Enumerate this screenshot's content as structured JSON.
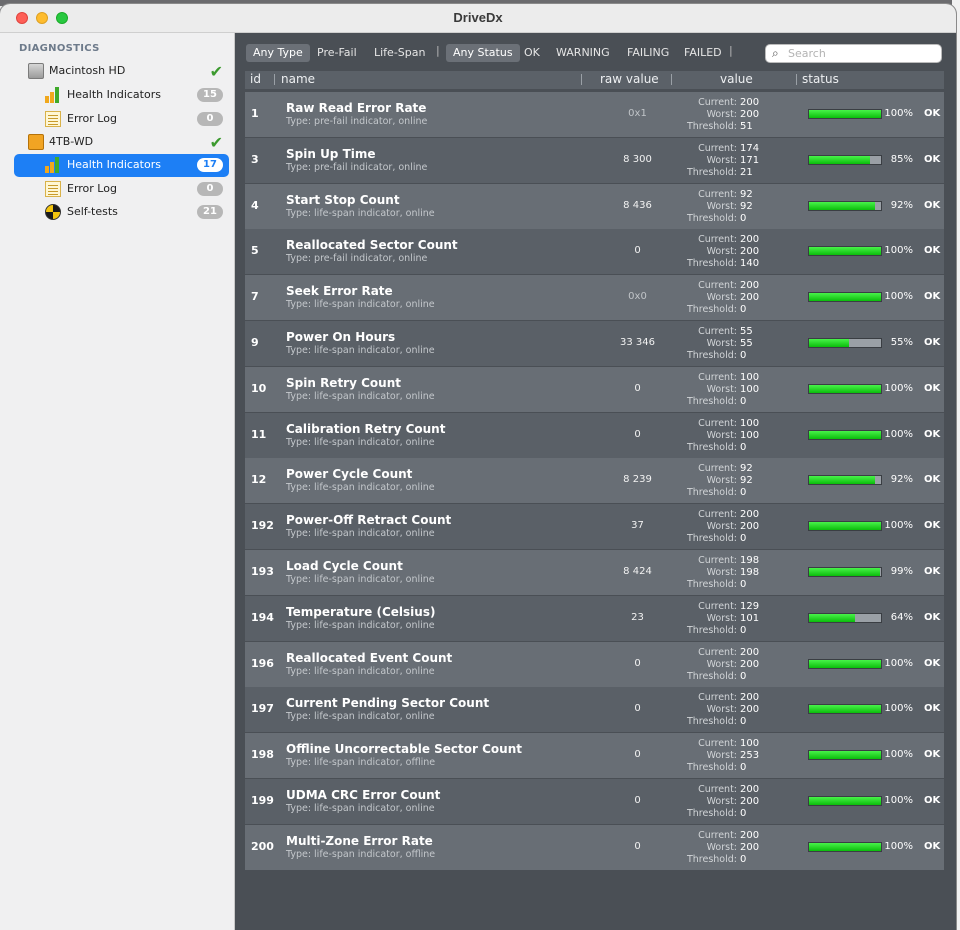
{
  "window": {
    "title": "DriveDx"
  },
  "sidebar": {
    "heading": "DIAGNOSTICS",
    "drives": [
      {
        "name": "Macintosh HD",
        "icon": "disk-icon",
        "status_icon": "check-icon",
        "items": [
          {
            "label": "Health Indicators",
            "icon": "bar-chart-icon",
            "count": "15"
          },
          {
            "label": "Error Log",
            "icon": "log-icon",
            "count": "0"
          }
        ]
      },
      {
        "name": "4TB-WD",
        "icon": "hdd-icon",
        "status_icon": "check-icon",
        "items": [
          {
            "label": "Health Indicators",
            "icon": "bar-chart-icon",
            "count": "17",
            "selected": true
          },
          {
            "label": "Error Log",
            "icon": "log-icon",
            "count": "0"
          },
          {
            "label": "Self-tests",
            "icon": "self-test-icon",
            "count": "21"
          }
        ]
      }
    ]
  },
  "filters": {
    "type": [
      "Any Type",
      "Pre-Fail",
      "Life-Span"
    ],
    "status": [
      "Any Status",
      "OK",
      "WARNING",
      "FAILING",
      "FAILED"
    ],
    "active_type": "Any Type",
    "active_status": "Any Status",
    "separator": "|",
    "search_placeholder": "Search"
  },
  "table": {
    "columns": [
      "id",
      "name",
      "raw value",
      "value",
      "status"
    ],
    "value_labels": {
      "current": "Current:",
      "worst": "Worst:",
      "threshold": "Threshold:"
    },
    "rows": [
      {
        "id": "1",
        "name": "Raw Read Error Rate",
        "type": "Type: pre-fail indicator, online",
        "raw": "0x1",
        "hex": true,
        "current": "200",
        "worst": "200",
        "threshold": "51",
        "percent": 100,
        "percent_label": "100%",
        "status": "OK"
      },
      {
        "id": "3",
        "name": "Spin Up Time",
        "type": "Type: pre-fail indicator, online",
        "raw": "8 300",
        "current": "174",
        "worst": "171",
        "threshold": "21",
        "percent": 85,
        "percent_label": "85%",
        "status": "OK"
      },
      {
        "id": "4",
        "name": "Start Stop Count",
        "type": "Type: life-span indicator, online",
        "raw": "8 436",
        "current": "92",
        "worst": "92",
        "threshold": "0",
        "percent": 92,
        "percent_label": "92%",
        "status": "OK"
      },
      {
        "id": "5",
        "name": "Reallocated Sector Count",
        "type": "Type: pre-fail indicator, online",
        "raw": "0",
        "current": "200",
        "worst": "200",
        "threshold": "140",
        "percent": 100,
        "percent_label": "100%",
        "status": "OK"
      },
      {
        "id": "7",
        "name": "Seek Error Rate",
        "type": "Type: life-span indicator, online",
        "raw": "0x0",
        "hex": true,
        "current": "200",
        "worst": "200",
        "threshold": "0",
        "percent": 100,
        "percent_label": "100%",
        "status": "OK"
      },
      {
        "id": "9",
        "name": "Power On Hours",
        "type": "Type: life-span indicator, online",
        "raw": "33 346",
        "current": "55",
        "worst": "55",
        "threshold": "0",
        "percent": 55,
        "percent_label": "55%",
        "status": "OK"
      },
      {
        "id": "10",
        "name": "Spin Retry Count",
        "type": "Type: life-span indicator, online",
        "raw": "0",
        "current": "100",
        "worst": "100",
        "threshold": "0",
        "percent": 100,
        "percent_label": "100%",
        "status": "OK"
      },
      {
        "id": "11",
        "name": "Calibration Retry Count",
        "type": "Type: life-span indicator, online",
        "raw": "0",
        "current": "100",
        "worst": "100",
        "threshold": "0",
        "percent": 100,
        "percent_label": "100%",
        "status": "OK"
      },
      {
        "id": "12",
        "name": "Power Cycle Count",
        "type": "Type: life-span indicator, online",
        "raw": "8 239",
        "current": "92",
        "worst": "92",
        "threshold": "0",
        "percent": 92,
        "percent_label": "92%",
        "status": "OK"
      },
      {
        "id": "192",
        "name": "Power-Off Retract Count",
        "type": "Type: life-span indicator, online",
        "raw": "37",
        "current": "200",
        "worst": "200",
        "threshold": "0",
        "percent": 100,
        "percent_label": "100%",
        "status": "OK"
      },
      {
        "id": "193",
        "name": "Load Cycle Count",
        "type": "Type: life-span indicator, online",
        "raw": "8 424",
        "current": "198",
        "worst": "198",
        "threshold": "0",
        "percent": 99,
        "percent_label": "99%",
        "status": "OK"
      },
      {
        "id": "194",
        "name": "Temperature (Celsius)",
        "type": "Type: life-span indicator, online",
        "raw": "23",
        "current": "129",
        "worst": "101",
        "threshold": "0",
        "percent": 64,
        "percent_label": "64%",
        "status": "OK"
      },
      {
        "id": "196",
        "name": "Reallocated Event Count",
        "type": "Type: life-span indicator, online",
        "raw": "0",
        "current": "200",
        "worst": "200",
        "threshold": "0",
        "percent": 100,
        "percent_label": "100%",
        "status": "OK"
      },
      {
        "id": "197",
        "name": "Current Pending Sector Count",
        "type": "Type: life-span indicator, online",
        "raw": "0",
        "current": "200",
        "worst": "200",
        "threshold": "0",
        "percent": 100,
        "percent_label": "100%",
        "status": "OK"
      },
      {
        "id": "198",
        "name": "Offline Uncorrectable Sector Count",
        "type": "Type: life-span indicator, offline",
        "raw": "0",
        "current": "100",
        "worst": "253",
        "threshold": "0",
        "percent": 100,
        "percent_label": "100%",
        "status": "OK"
      },
      {
        "id": "199",
        "name": "UDMA CRC Error Count",
        "type": "Type: life-span indicator, online",
        "raw": "0",
        "current": "200",
        "worst": "200",
        "threshold": "0",
        "percent": 100,
        "percent_label": "100%",
        "status": "OK"
      },
      {
        "id": "200",
        "name": "Multi-Zone Error Rate",
        "type": "Type: life-span indicator, offline",
        "raw": "0",
        "current": "200",
        "worst": "200",
        "threshold": "0",
        "percent": 100,
        "percent_label": "100%",
        "status": "OK"
      }
    ]
  }
}
